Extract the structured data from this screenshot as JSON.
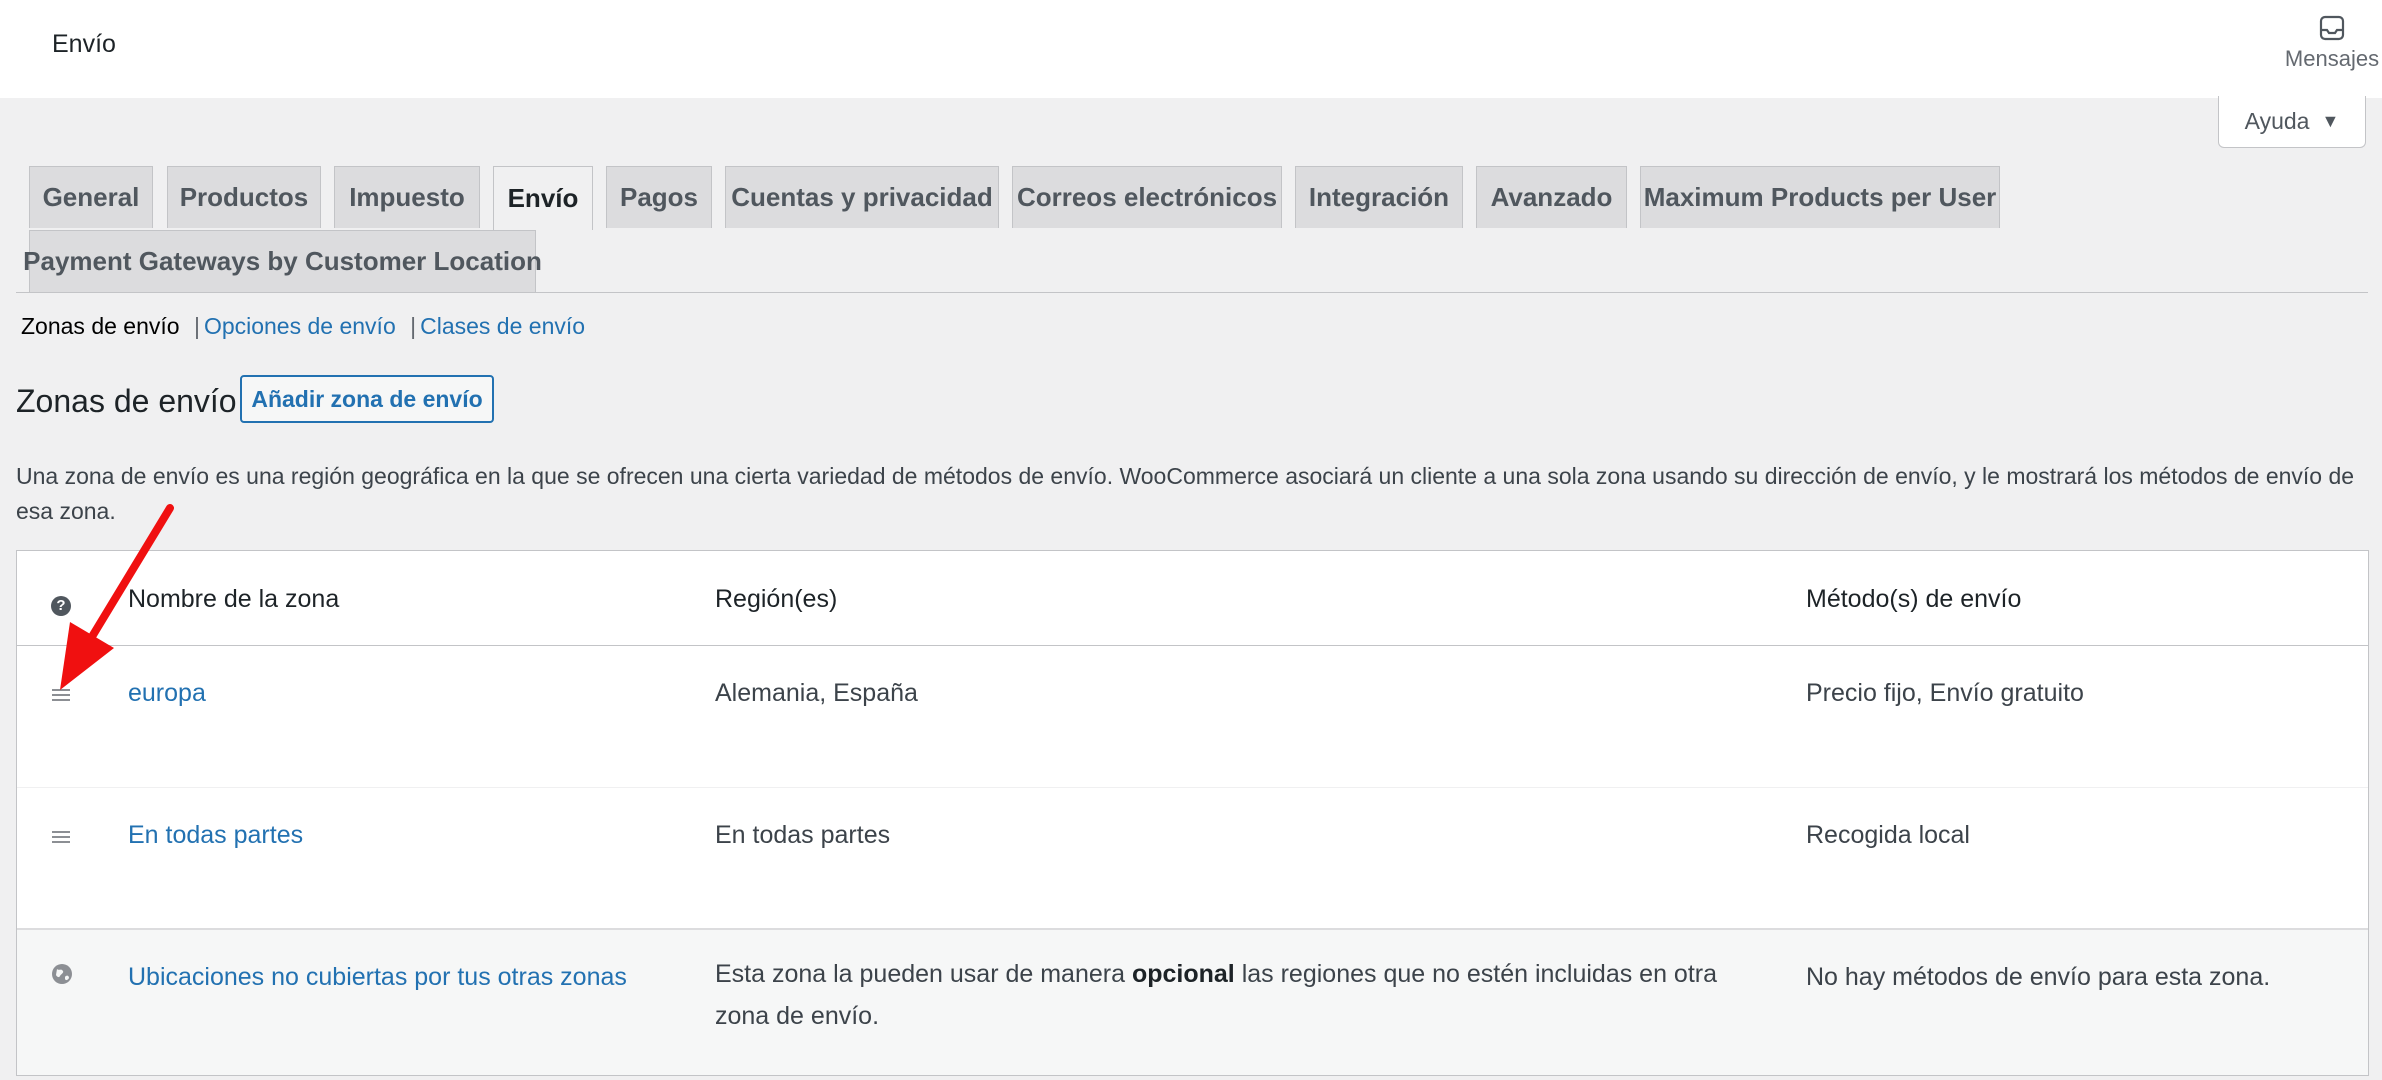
{
  "header": {
    "title": "Envío",
    "messages_label": "Mensajes",
    "help_label": "Ayuda"
  },
  "tabs": [
    {
      "label": "General",
      "active": false
    },
    {
      "label": "Productos",
      "active": false
    },
    {
      "label": "Impuesto",
      "active": false
    },
    {
      "label": "Envío",
      "active": true
    },
    {
      "label": "Pagos",
      "active": false
    },
    {
      "label": "Cuentas y privacidad",
      "active": false
    },
    {
      "label": "Correos electrónicos",
      "active": false
    },
    {
      "label": "Integración",
      "active": false
    },
    {
      "label": "Avanzado",
      "active": false
    },
    {
      "label": "Maximum Products per User",
      "active": false
    },
    {
      "label": "Payment Gateways by Customer Location",
      "active": false
    }
  ],
  "subnav": {
    "current": "Zonas de envío",
    "separator": "|",
    "options_link": "Opciones de envío",
    "classes_link": "Clases de envío"
  },
  "section": {
    "heading": "Zonas de envío",
    "add_button": "Añadir zona de envío",
    "description": "Una zona de envío es una región geográfica en la que se ofrecen una cierta variedad de métodos de envío. WooCommerce asociará un cliente a una sola zona usando su dirección de envío, y le mostrará los métodos de envío de esa zona."
  },
  "table": {
    "headers": {
      "help_icon": "?",
      "name": "Nombre de la zona",
      "regions": "Región(es)",
      "methods": "Método(s) de envío"
    },
    "rows": [
      {
        "name": "europa",
        "regions": "Alemania, España",
        "methods": "Precio fijo, Envío gratuito"
      },
      {
        "name": "En todas partes",
        "regions": "En todas partes",
        "methods": "Recogida local"
      }
    ],
    "fallback": {
      "name": "Ubicaciones no cubiertas por tus otras zonas",
      "regions_prefix": "Esta zona la pueden usar de manera ",
      "regions_bold": "opcional",
      "regions_suffix": " las regiones que no estén incluidas en otra zona de envío.",
      "methods": "No hay métodos de envío para esta zona."
    }
  },
  "colors": {
    "link": "#2271b1",
    "annotation_arrow": "#f01010"
  },
  "icons": [
    "inbox-icon",
    "caret-down-icon",
    "help-icon",
    "drag-handle-icon",
    "globe-icon"
  ]
}
